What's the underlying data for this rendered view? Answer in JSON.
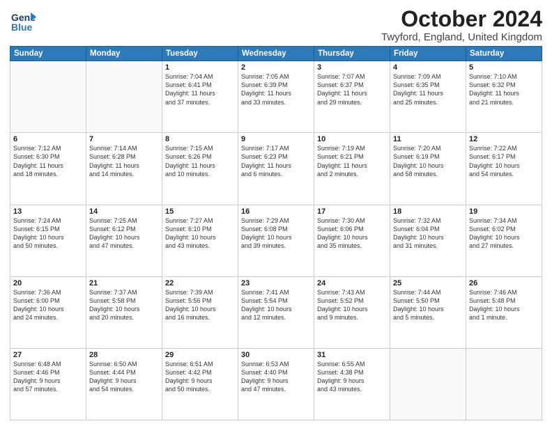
{
  "header": {
    "logo_line1": "General",
    "logo_line2": "Blue",
    "month": "October 2024",
    "location": "Twyford, England, United Kingdom"
  },
  "weekdays": [
    "Sunday",
    "Monday",
    "Tuesday",
    "Wednesday",
    "Thursday",
    "Friday",
    "Saturday"
  ],
  "weeks": [
    [
      {
        "day": "",
        "info": ""
      },
      {
        "day": "",
        "info": ""
      },
      {
        "day": "1",
        "info": "Sunrise: 7:04 AM\nSunset: 6:41 PM\nDaylight: 11 hours\nand 37 minutes."
      },
      {
        "day": "2",
        "info": "Sunrise: 7:05 AM\nSunset: 6:39 PM\nDaylight: 11 hours\nand 33 minutes."
      },
      {
        "day": "3",
        "info": "Sunrise: 7:07 AM\nSunset: 6:37 PM\nDaylight: 11 hours\nand 29 minutes."
      },
      {
        "day": "4",
        "info": "Sunrise: 7:09 AM\nSunset: 6:35 PM\nDaylight: 11 hours\nand 25 minutes."
      },
      {
        "day": "5",
        "info": "Sunrise: 7:10 AM\nSunset: 6:32 PM\nDaylight: 11 hours\nand 21 minutes."
      }
    ],
    [
      {
        "day": "6",
        "info": "Sunrise: 7:12 AM\nSunset: 6:30 PM\nDaylight: 11 hours\nand 18 minutes."
      },
      {
        "day": "7",
        "info": "Sunrise: 7:14 AM\nSunset: 6:28 PM\nDaylight: 11 hours\nand 14 minutes."
      },
      {
        "day": "8",
        "info": "Sunrise: 7:15 AM\nSunset: 6:26 PM\nDaylight: 11 hours\nand 10 minutes."
      },
      {
        "day": "9",
        "info": "Sunrise: 7:17 AM\nSunset: 6:23 PM\nDaylight: 11 hours\nand 6 minutes."
      },
      {
        "day": "10",
        "info": "Sunrise: 7:19 AM\nSunset: 6:21 PM\nDaylight: 11 hours\nand 2 minutes."
      },
      {
        "day": "11",
        "info": "Sunrise: 7:20 AM\nSunset: 6:19 PM\nDaylight: 10 hours\nand 58 minutes."
      },
      {
        "day": "12",
        "info": "Sunrise: 7:22 AM\nSunset: 6:17 PM\nDaylight: 10 hours\nand 54 minutes."
      }
    ],
    [
      {
        "day": "13",
        "info": "Sunrise: 7:24 AM\nSunset: 6:15 PM\nDaylight: 10 hours\nand 50 minutes."
      },
      {
        "day": "14",
        "info": "Sunrise: 7:25 AM\nSunset: 6:12 PM\nDaylight: 10 hours\nand 47 minutes."
      },
      {
        "day": "15",
        "info": "Sunrise: 7:27 AM\nSunset: 6:10 PM\nDaylight: 10 hours\nand 43 minutes."
      },
      {
        "day": "16",
        "info": "Sunrise: 7:29 AM\nSunset: 6:08 PM\nDaylight: 10 hours\nand 39 minutes."
      },
      {
        "day": "17",
        "info": "Sunrise: 7:30 AM\nSunset: 6:06 PM\nDaylight: 10 hours\nand 35 minutes."
      },
      {
        "day": "18",
        "info": "Sunrise: 7:32 AM\nSunset: 6:04 PM\nDaylight: 10 hours\nand 31 minutes."
      },
      {
        "day": "19",
        "info": "Sunrise: 7:34 AM\nSunset: 6:02 PM\nDaylight: 10 hours\nand 27 minutes."
      }
    ],
    [
      {
        "day": "20",
        "info": "Sunrise: 7:36 AM\nSunset: 6:00 PM\nDaylight: 10 hours\nand 24 minutes."
      },
      {
        "day": "21",
        "info": "Sunrise: 7:37 AM\nSunset: 5:58 PM\nDaylight: 10 hours\nand 20 minutes."
      },
      {
        "day": "22",
        "info": "Sunrise: 7:39 AM\nSunset: 5:56 PM\nDaylight: 10 hours\nand 16 minutes."
      },
      {
        "day": "23",
        "info": "Sunrise: 7:41 AM\nSunset: 5:54 PM\nDaylight: 10 hours\nand 12 minutes."
      },
      {
        "day": "24",
        "info": "Sunrise: 7:43 AM\nSunset: 5:52 PM\nDaylight: 10 hours\nand 9 minutes."
      },
      {
        "day": "25",
        "info": "Sunrise: 7:44 AM\nSunset: 5:50 PM\nDaylight: 10 hours\nand 5 minutes."
      },
      {
        "day": "26",
        "info": "Sunrise: 7:46 AM\nSunset: 5:48 PM\nDaylight: 10 hours\nand 1 minute."
      }
    ],
    [
      {
        "day": "27",
        "info": "Sunrise: 6:48 AM\nSunset: 4:46 PM\nDaylight: 9 hours\nand 57 minutes."
      },
      {
        "day": "28",
        "info": "Sunrise: 6:50 AM\nSunset: 4:44 PM\nDaylight: 9 hours\nand 54 minutes."
      },
      {
        "day": "29",
        "info": "Sunrise: 6:51 AM\nSunset: 4:42 PM\nDaylight: 9 hours\nand 50 minutes."
      },
      {
        "day": "30",
        "info": "Sunrise: 6:53 AM\nSunset: 4:40 PM\nDaylight: 9 hours\nand 47 minutes."
      },
      {
        "day": "31",
        "info": "Sunrise: 6:55 AM\nSunset: 4:38 PM\nDaylight: 9 hours\nand 43 minutes."
      },
      {
        "day": "",
        "info": ""
      },
      {
        "day": "",
        "info": ""
      }
    ]
  ]
}
